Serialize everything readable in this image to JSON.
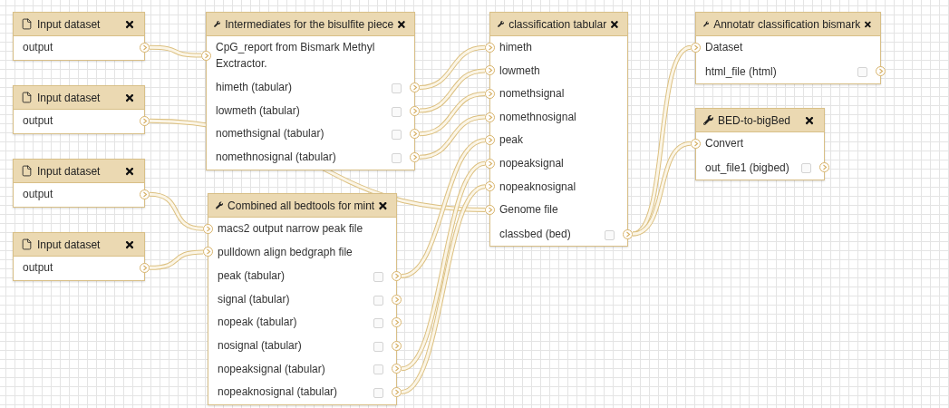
{
  "nodes": [
    {
      "kind": "input",
      "title": "Input dataset",
      "outputs": [
        {
          "label": "output"
        }
      ]
    },
    {
      "kind": "input",
      "title": "Input dataset",
      "outputs": [
        {
          "label": "output"
        }
      ]
    },
    {
      "kind": "input",
      "title": "Input dataset",
      "outputs": [
        {
          "label": "output"
        }
      ]
    },
    {
      "kind": "input",
      "title": "Input dataset",
      "outputs": [
        {
          "label": "output"
        }
      ]
    },
    {
      "kind": "tool",
      "title": "Intermediates for the bisulfite piece",
      "inputs": [
        {
          "label": "CpG_report from Bismark Methyl Exctractor."
        }
      ],
      "outputs": [
        {
          "label": "himeth (tabular)",
          "checked": false
        },
        {
          "label": "lowmeth (tabular)",
          "checked": false
        },
        {
          "label": "nomethsignal (tabular)",
          "checked": false
        },
        {
          "label": "nomethnosignal (tabular)",
          "checked": false
        }
      ]
    },
    {
      "kind": "tool",
      "title": "Combined all bedtools for mint",
      "inputs": [
        {
          "label": "macs2 output narrow peak file"
        },
        {
          "label": "pulldown align bedgraph file"
        }
      ],
      "outputs": [
        {
          "label": "peak (tabular)",
          "checked": false
        },
        {
          "label": "signal (tabular)",
          "checked": false
        },
        {
          "label": "nopeak (tabular)",
          "checked": false
        },
        {
          "label": "nosignal (tabular)",
          "checked": false
        },
        {
          "label": "nopeaksignal (tabular)",
          "checked": false
        },
        {
          "label": "nopeaknosignal (tabular)",
          "checked": false
        }
      ]
    },
    {
      "kind": "tool",
      "title": "classification tabular",
      "inputs": [
        {
          "label": "himeth"
        },
        {
          "label": "lowmeth"
        },
        {
          "label": "nomethsignal"
        },
        {
          "label": "nomethnosignal"
        },
        {
          "label": "peak"
        },
        {
          "label": "nopeaksignal"
        },
        {
          "label": "nopeaknosignal"
        },
        {
          "label": "Genome file"
        }
      ],
      "outputs": [
        {
          "label": "classbed (bed)",
          "checked": false
        }
      ]
    },
    {
      "kind": "tool",
      "title": "Annotatr classification bismark",
      "inputs": [
        {
          "label": "Dataset"
        }
      ],
      "outputs": [
        {
          "label": "html_file (html)",
          "checked": false
        }
      ]
    },
    {
      "kind": "tool",
      "title": "BED-to-bigBed",
      "inputs": [
        {
          "label": "Convert"
        }
      ],
      "outputs": [
        {
          "label": "out_file1 (bigbed)",
          "checked": false
        }
      ]
    }
  ]
}
